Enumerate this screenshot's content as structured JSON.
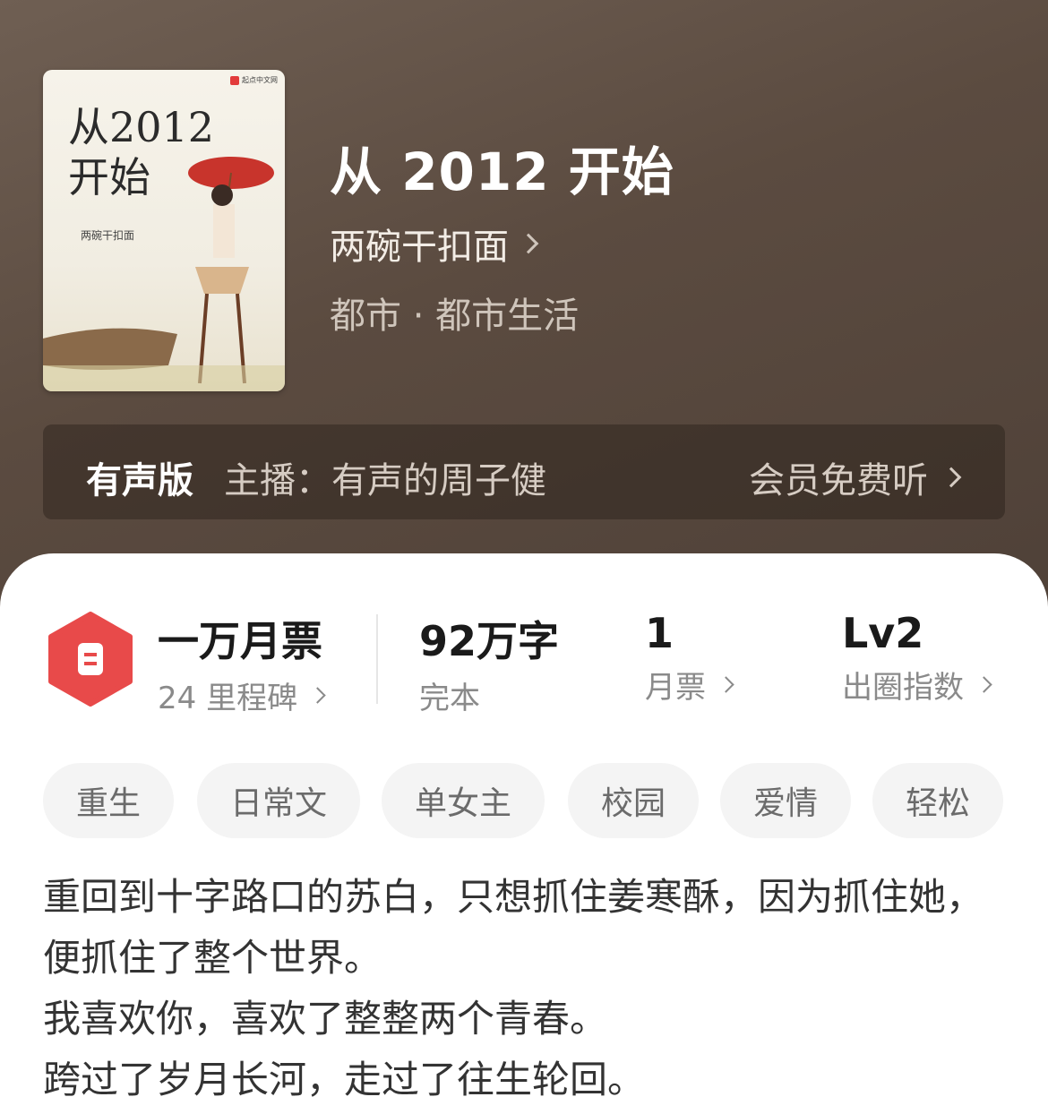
{
  "cover": {
    "title": "从2012\n开始",
    "author": "两碗干扣面",
    "publisher": "起点中文网"
  },
  "book": {
    "title": "从 2012 开始",
    "author": "两碗干扣面",
    "category": "都市 · 都市生活"
  },
  "audio": {
    "label": "有声版",
    "host": "主播：有声的周子健",
    "cta": "会员免费听"
  },
  "stats": {
    "milestone_title": "一万月票",
    "milestone_sub": "24 里程碑",
    "words": "92万字",
    "status": "完本",
    "monthly_votes": "1",
    "monthly_votes_label": "月票",
    "level": "Lv2",
    "level_label": "出圈指数"
  },
  "tags": [
    "重生",
    "日常文",
    "单女主",
    "校园",
    "爱情",
    "轻松"
  ],
  "description": [
    "重回到十字路口的苏白，只想抓住姜寒酥，因为抓住她，便抓住了整个世界。",
    "我喜欢你，喜欢了整整两个青春。",
    "跨过了岁月长河，走过了往生轮回。"
  ],
  "colors": {
    "hero_bg": "#5b4b40",
    "badge_red": "#e84a4a",
    "tag_bg": "#f4f4f4"
  }
}
